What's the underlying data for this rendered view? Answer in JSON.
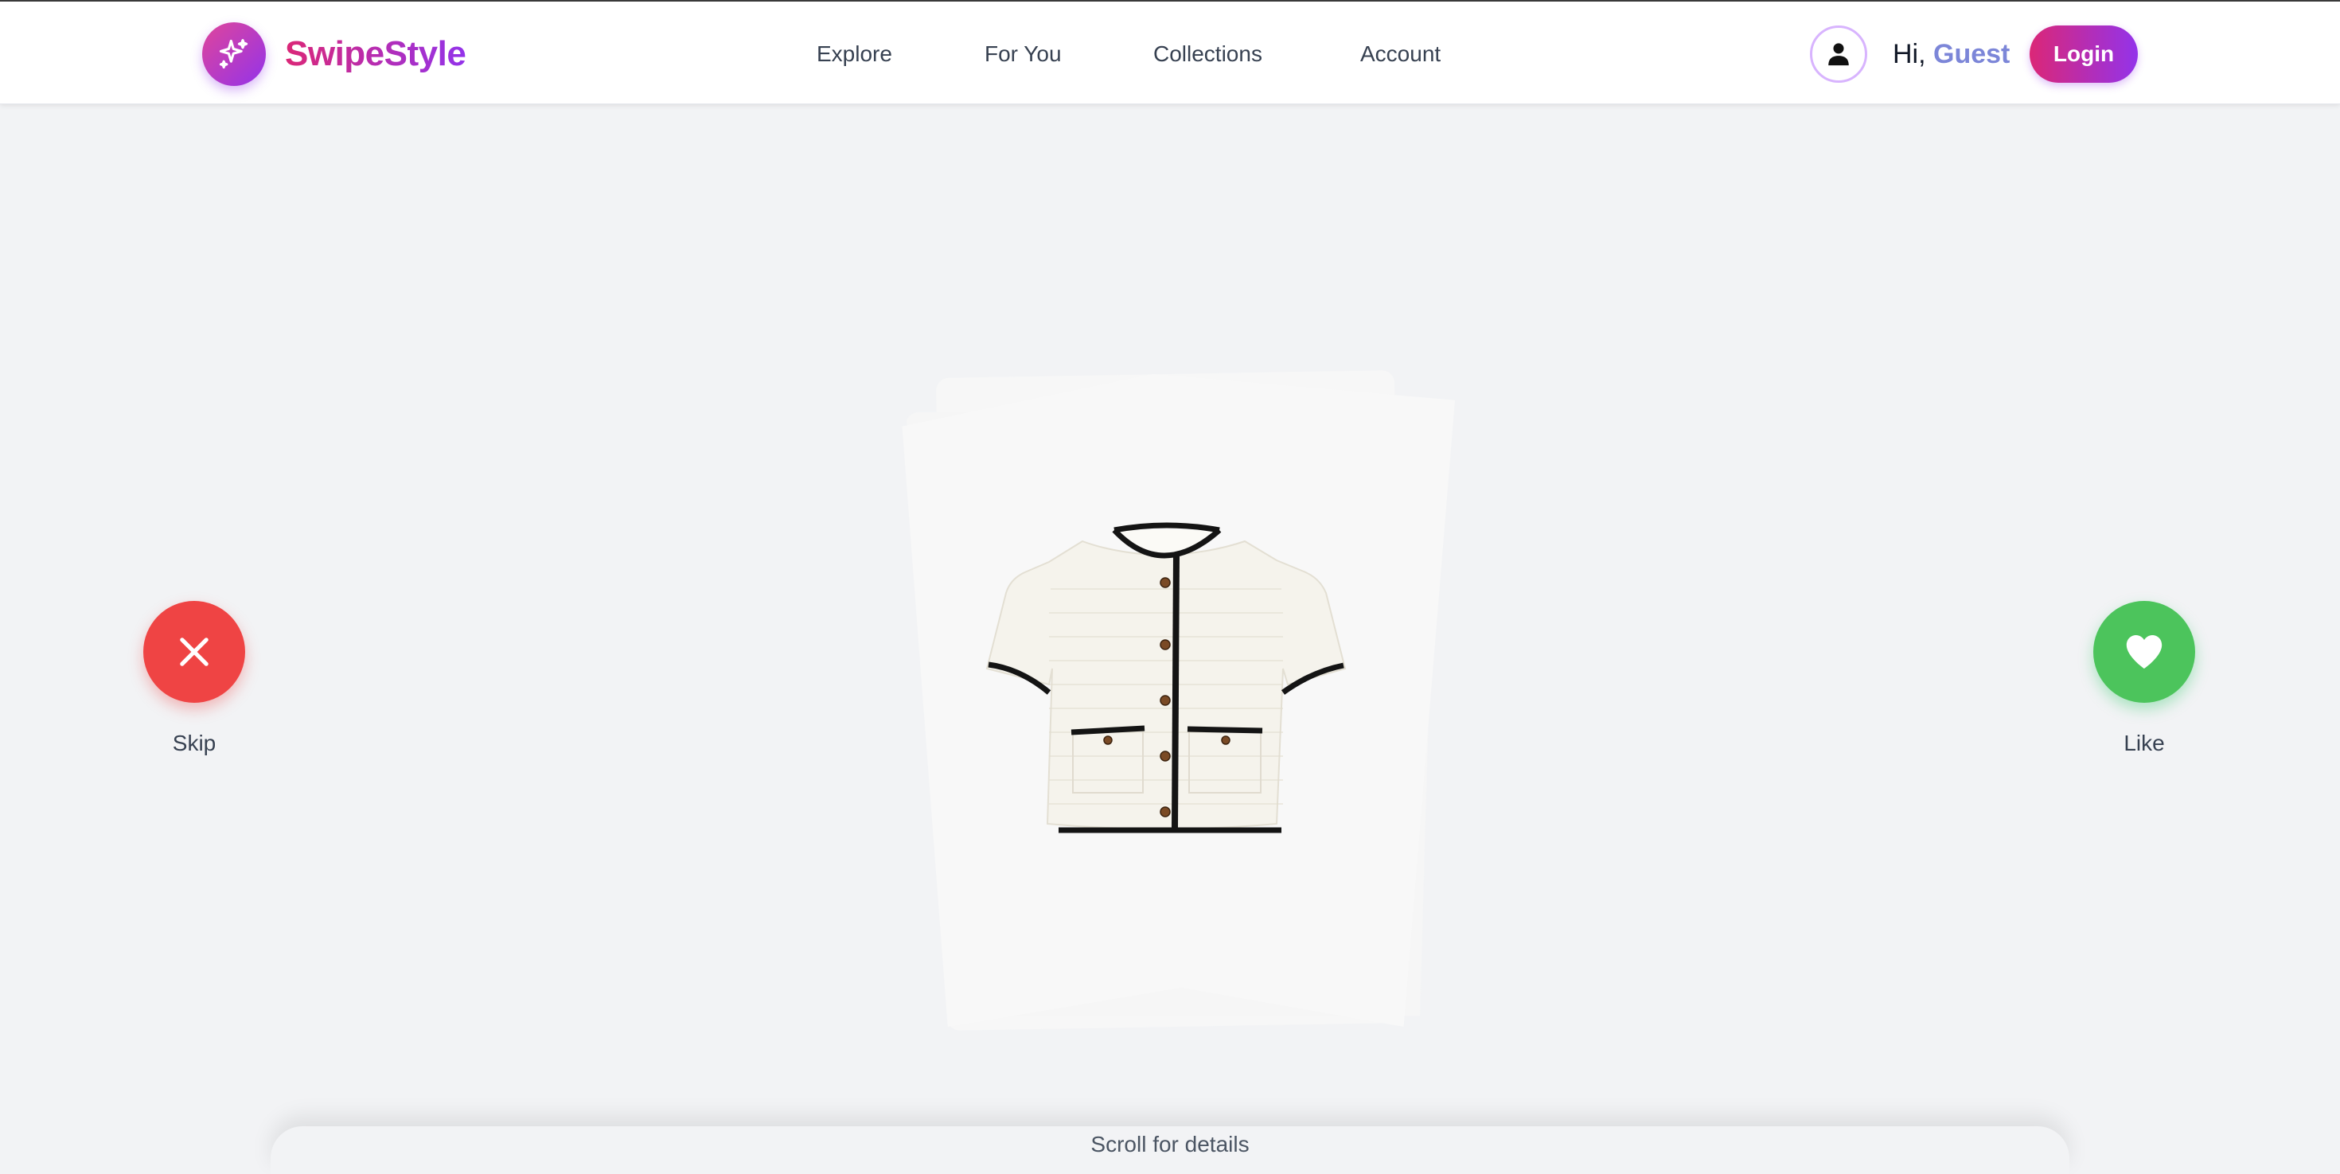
{
  "brand": {
    "name": "SwipeStyle",
    "logo_icon": "sparkles-icon",
    "gradient_start": "#db2777",
    "gradient_end": "#9333ea"
  },
  "nav": {
    "items": [
      {
        "label": "Explore"
      },
      {
        "label": "For You"
      },
      {
        "label": "Collections"
      },
      {
        "label": "Account"
      }
    ]
  },
  "user": {
    "avatar_icon": "user-icon",
    "greeting_prefix": "Hi,",
    "name": "Guest",
    "name_color": "#7c86d8",
    "login_label": "Login"
  },
  "product": {
    "image_icon": "cardigan-image",
    "description": "cream knit short-sleeve cardigan with black trim and gold buttons"
  },
  "actions": {
    "skip": {
      "label": "Skip",
      "icon": "close-icon",
      "color": "#ef4444"
    },
    "like": {
      "label": "Like",
      "icon": "heart-icon",
      "color": "#4cc45c"
    }
  },
  "details": {
    "scroll_hint": "Scroll for details"
  }
}
